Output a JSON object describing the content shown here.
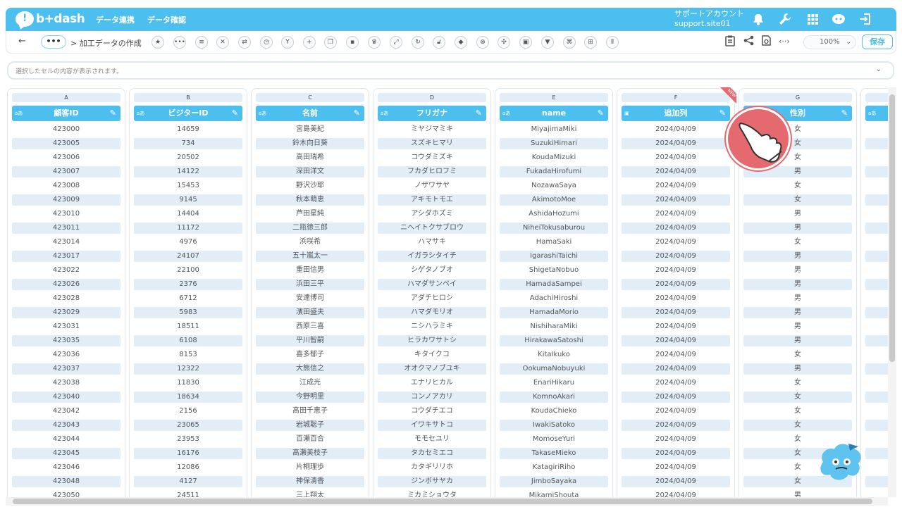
{
  "header": {
    "logo": "b+dash",
    "nav": [
      "データ連携",
      "データ確認"
    ],
    "account_name": "サポートアカウント",
    "account_id": "support.site01"
  },
  "toolbar": {
    "breadcrumb": "> 加工データの作成",
    "dots": "•••",
    "zoom": "100%",
    "save": "保存"
  },
  "cellbox": {
    "placeholder": "選択したセルの内容が表示されます。"
  },
  "badge": "NEW",
  "columns": [
    {
      "letter": "A",
      "name": "顧客ID",
      "type": "aあ"
    },
    {
      "letter": "B",
      "name": "ビジターID",
      "type": "aあ"
    },
    {
      "letter": "C",
      "name": "名前",
      "type": "aあ"
    },
    {
      "letter": "D",
      "name": "フリガナ",
      "type": "aあ"
    },
    {
      "letter": "E",
      "name": "name",
      "type": "aあ"
    },
    {
      "letter": "F",
      "name": "追加列",
      "type": "calendar"
    },
    {
      "letter": "G",
      "name": "性別",
      "type": "aあ"
    }
  ],
  "rows": [
    [
      "423000",
      "14659",
      "宮島美紀",
      "ミヤジマミキ",
      "MiyajimaMiki",
      "2024/04/09",
      "女"
    ],
    [
      "423005",
      "734",
      "鈴木向日葵",
      "スズキヒマリ",
      "SuzukiHimari",
      "2024/04/09",
      "女"
    ],
    [
      "423006",
      "20502",
      "高田瑞希",
      "コウダミズキ",
      "KoudaMizuki",
      "2024/04/09",
      "女"
    ],
    [
      "423007",
      "14122",
      "深田洋文",
      "フカダヒロフミ",
      "FukadaHirofumi",
      "2024/04/09",
      "男"
    ],
    [
      "423008",
      "15453",
      "野沢沙耶",
      "ノザワサヤ",
      "NozawaSaya",
      "2024/04/09",
      "女"
    ],
    [
      "423009",
      "9145",
      "秋本萌恵",
      "アキモトモエ",
      "AkimotoMoe",
      "2024/04/09",
      "女"
    ],
    [
      "423010",
      "14404",
      "芦田星純",
      "アシダホズミ",
      "AshidaHozumi",
      "2024/04/09",
      "男"
    ],
    [
      "423011",
      "11172",
      "二瓶徳三郎",
      "ニヘイトクサブロウ",
      "NiheiTokusaburou",
      "2024/04/09",
      "男"
    ],
    [
      "423014",
      "4976",
      "浜咲希",
      "ハマサキ",
      "HamaSaki",
      "2024/04/09",
      "女"
    ],
    [
      "423017",
      "24107",
      "五十嵐太一",
      "イガラシタイチ",
      "IgarashiTaichi",
      "2024/04/09",
      "男"
    ],
    [
      "423022",
      "22100",
      "重田信男",
      "シゲタノブオ",
      "ShigetaNobuo",
      "2024/04/09",
      "男"
    ],
    [
      "423026",
      "2376",
      "浜田三平",
      "ハマダサンペイ",
      "HamadaSampei",
      "2024/04/09",
      "男"
    ],
    [
      "423028",
      "6712",
      "安達博司",
      "アダチヒロシ",
      "AdachiHiroshi",
      "2024/04/09",
      "男"
    ],
    [
      "423029",
      "5983",
      "濱田盛夫",
      "ハマダモリオ",
      "HamadaMorio",
      "2024/04/09",
      "男"
    ],
    [
      "423031",
      "18511",
      "西原三喜",
      "ニシハラミキ",
      "NishiharaMiki",
      "2024/04/09",
      "男"
    ],
    [
      "423035",
      "6108",
      "平川智嗣",
      "ヒラカワサトシ",
      "HirakawaSatoshi",
      "2024/04/09",
      "男"
    ],
    [
      "423036",
      "8153",
      "喜多郁子",
      "キタイクコ",
      "KitaIkuko",
      "2024/04/09",
      "女"
    ],
    [
      "423037",
      "12322",
      "大熊信之",
      "オオクマノブユキ",
      "OokumaNobuyuki",
      "2024/04/09",
      "男"
    ],
    [
      "423038",
      "11830",
      "江成光",
      "エナリヒカル",
      "EnariHikaru",
      "2024/04/09",
      "女"
    ],
    [
      "423040",
      "18634",
      "今野明里",
      "コンノアカリ",
      "KomnoAkari",
      "2024/04/09",
      "女"
    ],
    [
      "423042",
      "2156",
      "高田千恵子",
      "コウダチエコ",
      "KoudaChieko",
      "2024/04/09",
      "女"
    ],
    [
      "423043",
      "23065",
      "岩城聡子",
      "イワキサトコ",
      "IwakiSatoko",
      "2024/04/09",
      "女"
    ],
    [
      "423044",
      "23953",
      "百瀬百合",
      "モモセユリ",
      "MomoseYuri",
      "2024/04/09",
      "女"
    ],
    [
      "423045",
      "16176",
      "高瀬美枝子",
      "タカセミエコ",
      "TakaseMieko",
      "2024/04/09",
      "女"
    ],
    [
      "423046",
      "12086",
      "片桐理歩",
      "カタギリリホ",
      "KatagiriRiho",
      "2024/04/09",
      "女"
    ],
    [
      "423048",
      "4127",
      "神保清香",
      "ジンボサヤカ",
      "JimboSayaka",
      "2024/04/09",
      "女"
    ],
    [
      "423050",
      "24511",
      "三上翔太",
      "ミカミショウタ",
      "MikamiShouta",
      "2024/04/09",
      "男"
    ]
  ]
}
